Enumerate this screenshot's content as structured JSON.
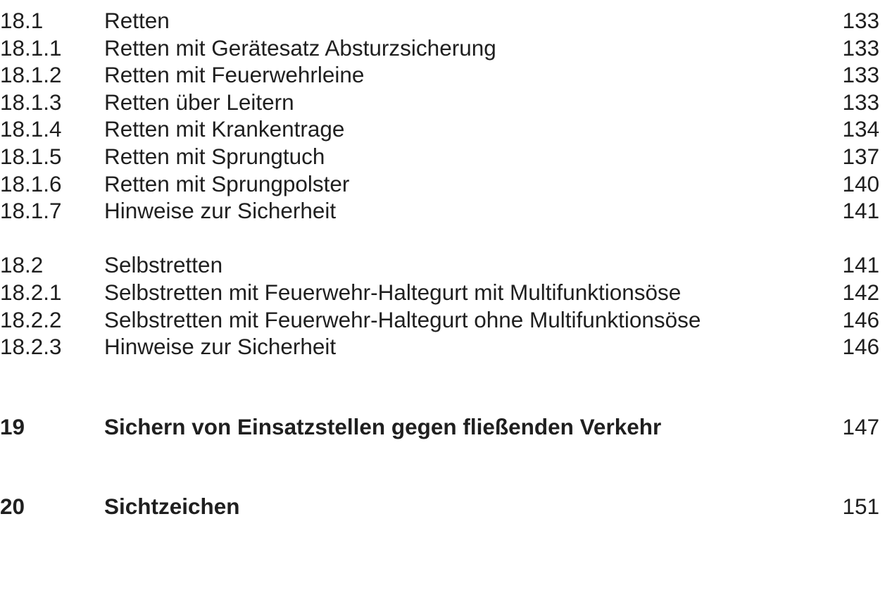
{
  "entries": [
    {
      "num": "18.1",
      "title": "Retten",
      "page": "133"
    },
    {
      "num": "18.1.1",
      "title": "Retten mit Gerätesatz Absturzsicherung",
      "page": "133"
    },
    {
      "num": "18.1.2",
      "title": "Retten mit Feuerwehrleine",
      "page": "133"
    },
    {
      "num": "18.1.3",
      "title": "Retten über Leitern",
      "page": "133"
    },
    {
      "num": "18.1.4",
      "title": "Retten mit Krankentrage",
      "page": "134"
    },
    {
      "num": "18.1.5",
      "title": "Retten mit Sprungtuch",
      "page": "137"
    },
    {
      "num": "18.1.6",
      "title": "Retten mit Sprungpolster",
      "page": "140"
    },
    {
      "num": "18.1.7",
      "title": "Hinweise zur Sicherheit",
      "page": "141"
    },
    {
      "num": "18.2",
      "title": "Selbstretten",
      "page": "141"
    },
    {
      "num": "18.2.1",
      "title": "Selbstretten mit Feuerwehr-Haltegurt mit Multifunktionsöse",
      "page": "142"
    },
    {
      "num": "18.2.2",
      "title": "Selbstretten mit Feuerwehr-Haltegurt ohne Multifunktionsöse",
      "page": "146"
    },
    {
      "num": "18.2.3",
      "title": "Hinweise zur Sicherheit",
      "page": "146"
    },
    {
      "num": "19",
      "title": "Sichern von Einsatzstellen gegen fließenden Verkehr",
      "page": "147"
    },
    {
      "num": "20",
      "title": "Sichtzeichen",
      "page": "151"
    }
  ]
}
